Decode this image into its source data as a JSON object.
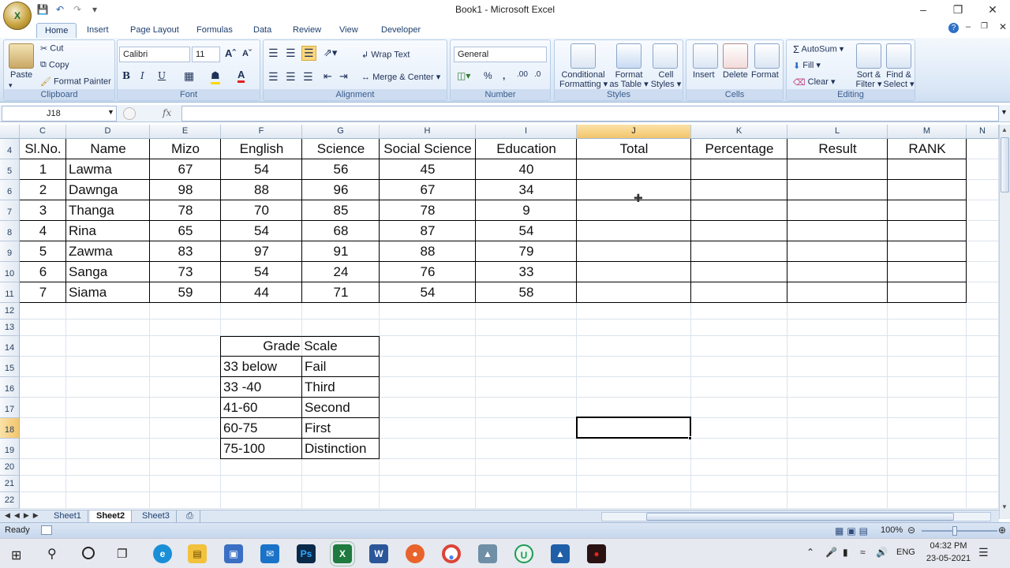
{
  "window": {
    "title": "Book1 - Microsoft Excel",
    "orb_label": "X"
  },
  "ribbon_tabs": [
    "Home",
    "Insert",
    "Page Layout",
    "Formulas",
    "Data",
    "Review",
    "View",
    "Developer"
  ],
  "clipboard": {
    "paste": "Paste",
    "cut": "Cut",
    "copy": "Copy",
    "format_painter": "Format Painter",
    "label": "Clipboard"
  },
  "font": {
    "name": "Calibri",
    "size": "11",
    "bold": "B",
    "italic": "I",
    "underline": "U",
    "label": "Font"
  },
  "alignment": {
    "wrap_text": "Wrap Text",
    "merge_center": "Merge & Center",
    "label": "Alignment"
  },
  "number": {
    "format": "General",
    "percent": "%",
    "comma": ",",
    "label": "Number"
  },
  "styles": {
    "conditional": [
      "Conditional",
      "Formatting"
    ],
    "format_table": [
      "Format",
      "as Table"
    ],
    "cell_styles": [
      "Cell",
      "Styles"
    ],
    "label": "Styles"
  },
  "cells": {
    "insert": "Insert",
    "delete": "Delete",
    "format": "Format",
    "label": "Cells"
  },
  "editing": {
    "autosum": "AutoSum",
    "fill": "Fill",
    "clear": "Clear",
    "sort_filter": [
      "Sort &",
      "Filter"
    ],
    "find_select": [
      "Find &",
      "Select"
    ],
    "label": "Editing"
  },
  "formula_bar": {
    "name_box": "J18",
    "fx": "fx",
    "value": ""
  },
  "columns": [
    "C",
    "D",
    "E",
    "F",
    "G",
    "H",
    "I",
    "J",
    "K",
    "L",
    "M",
    "N"
  ],
  "selected_column": "J",
  "rows": [
    "4",
    "5",
    "6",
    "7",
    "8",
    "9",
    "10",
    "11",
    "12",
    "13",
    "14",
    "15",
    "16",
    "17",
    "18",
    "19",
    "20",
    "21",
    "22"
  ],
  "selected_row": "18",
  "table": {
    "headers": [
      "Sl.No.",
      "Name",
      "Mizo",
      "English",
      "Science",
      "Social Science",
      "Education",
      "Total",
      "Percentage",
      "Result",
      "RANK"
    ],
    "rows": [
      [
        "1",
        "Lawma",
        "67",
        "54",
        "56",
        "45",
        "40",
        "",
        "",
        "",
        ""
      ],
      [
        "2",
        "Dawnga",
        "98",
        "88",
        "96",
        "67",
        "34",
        "",
        "",
        "",
        ""
      ],
      [
        "3",
        "Thanga",
        "78",
        "70",
        "85",
        "78",
        "9",
        "",
        "",
        "",
        ""
      ],
      [
        "4",
        "Rina",
        "65",
        "54",
        "68",
        "87",
        "54",
        "",
        "",
        "",
        ""
      ],
      [
        "5",
        "Zawma",
        "83",
        "97",
        "91",
        "88",
        "79",
        "",
        "",
        "",
        ""
      ],
      [
        "6",
        "Sanga",
        "73",
        "54",
        "24",
        "76",
        "33",
        "",
        "",
        "",
        ""
      ],
      [
        "7",
        "Siama",
        "59",
        "44",
        "71",
        "54",
        "58",
        "",
        "",
        "",
        ""
      ]
    ]
  },
  "grade_scale": {
    "title": "Grade Scale",
    "rows": [
      [
        "33 below",
        "Fail"
      ],
      [
        "33 -40",
        "Third"
      ],
      [
        "41-60",
        "Second"
      ],
      [
        "60-75",
        "First"
      ],
      [
        "75-100",
        "Distinction"
      ]
    ]
  },
  "sheets": [
    "Sheet1",
    "Sheet2",
    "Sheet3"
  ],
  "active_sheet": "Sheet2",
  "status": {
    "ready": "Ready",
    "zoom": "100%"
  },
  "taskbar": {
    "time": "04:32 PM",
    "date": "23-05-2021",
    "lang": "ENG"
  },
  "colors": {
    "accent": "#2b579a",
    "selected_header": "#f3c56b"
  }
}
